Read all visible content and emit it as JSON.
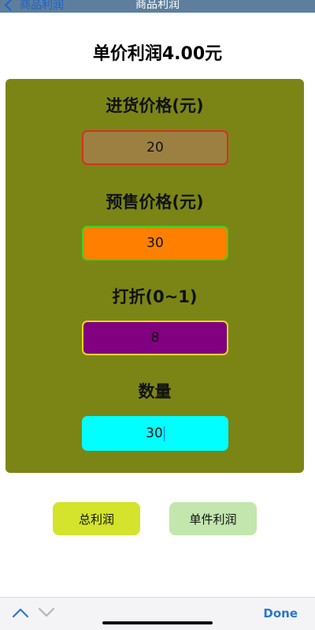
{
  "nav": {
    "back_label": "商品利润",
    "title": "商品利润"
  },
  "result": {
    "unit_profit_text": "单价利润4.00元"
  },
  "form": {
    "cost_label": "进货价格(元)",
    "cost_value": "20",
    "price_label": "预售价格(元)",
    "price_value": "30",
    "discount_label": "打折(0~1)",
    "discount_value": "8",
    "quantity_label": "数量",
    "quantity_value": "30"
  },
  "buttons": {
    "total_profit": "总利润",
    "unit_profit": "单件利润"
  },
  "keyboard_toolbar": {
    "done_label": "Done",
    "prev_icon": "chevron-up-icon",
    "next_icon": "chevron-down-icon"
  },
  "colors": {
    "panel_bg": "#7b8516",
    "cost_bg": "#9c8042",
    "cost_border": "#d7301f",
    "price_bg": "#ff8000",
    "price_border": "#40d020",
    "discount_bg": "#800080",
    "discount_border": "#e8d820",
    "quantity_bg": "#00ffff",
    "total_button_bg": "#d4e32b",
    "unit_button_bg": "#c3e6ae",
    "accent_blue": "#2a76d2"
  }
}
